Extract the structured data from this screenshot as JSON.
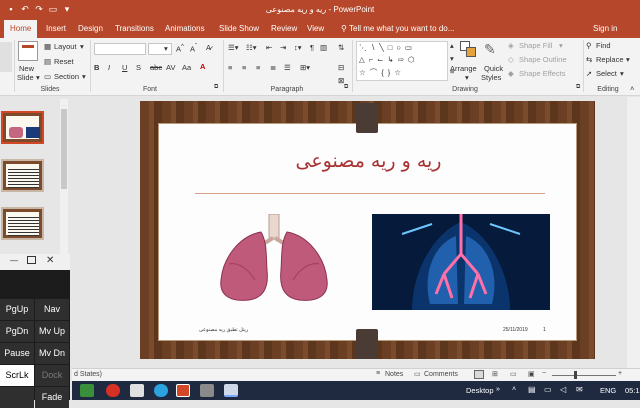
{
  "window": {
    "title": "ریه و ریه مصنوعی  -  PowerPoint",
    "user": "Sign in"
  },
  "tabs": [
    "Home",
    "Insert",
    "Design",
    "Transitions",
    "Animations",
    "Slide Show",
    "Review",
    "View"
  ],
  "active_tab": "Home",
  "tell_me": "Tell me what you want to do...",
  "share_label": "Share",
  "ribbon": {
    "slides": {
      "new_slide": "New",
      "new_slide2": "Slide",
      "layout": "Layout",
      "reset": "Reset",
      "section": "Section",
      "label": "Slides"
    },
    "font": {
      "label": "Font"
    },
    "paragraph": {
      "label": "Paragraph"
    },
    "drawing": {
      "arrange": "Arrange",
      "quick_styles": "Quick",
      "quick_styles2": "Styles",
      "shape_fill": "Shape Fill",
      "shape_outline": "Shape Outline",
      "shape_effects": "Shape Effects",
      "label": "Drawing"
    },
    "editing": {
      "find": "Find",
      "replace": "Replace",
      "select": "Select",
      "label": "Editing"
    }
  },
  "slide": {
    "title": "ریه و ریه مصنوعی",
    "footer_left": "ریتل تطبق ریه مصنوعی",
    "footer_date": "25/11/2019",
    "footer_page": "1"
  },
  "thumbnails": [
    "1",
    "2",
    "3"
  ],
  "osk_keys": [
    [
      "PgUp",
      "Nav"
    ],
    [
      "PgDn",
      "Mv Up"
    ],
    [
      "Pause",
      "Mv Dn"
    ],
    [
      "ScrLk",
      "Dock"
    ],
    [
      "",
      "Fade"
    ]
  ],
  "status": {
    "left": "d States)",
    "notes": "Notes",
    "comments": "Comments"
  },
  "taskbar": {
    "desktop": "Desktop",
    "lang": "ENG",
    "time": "05:1"
  },
  "colors": {
    "accent": "#b7472a",
    "wood": "#6a3f24",
    "title_text": "#a83232"
  }
}
